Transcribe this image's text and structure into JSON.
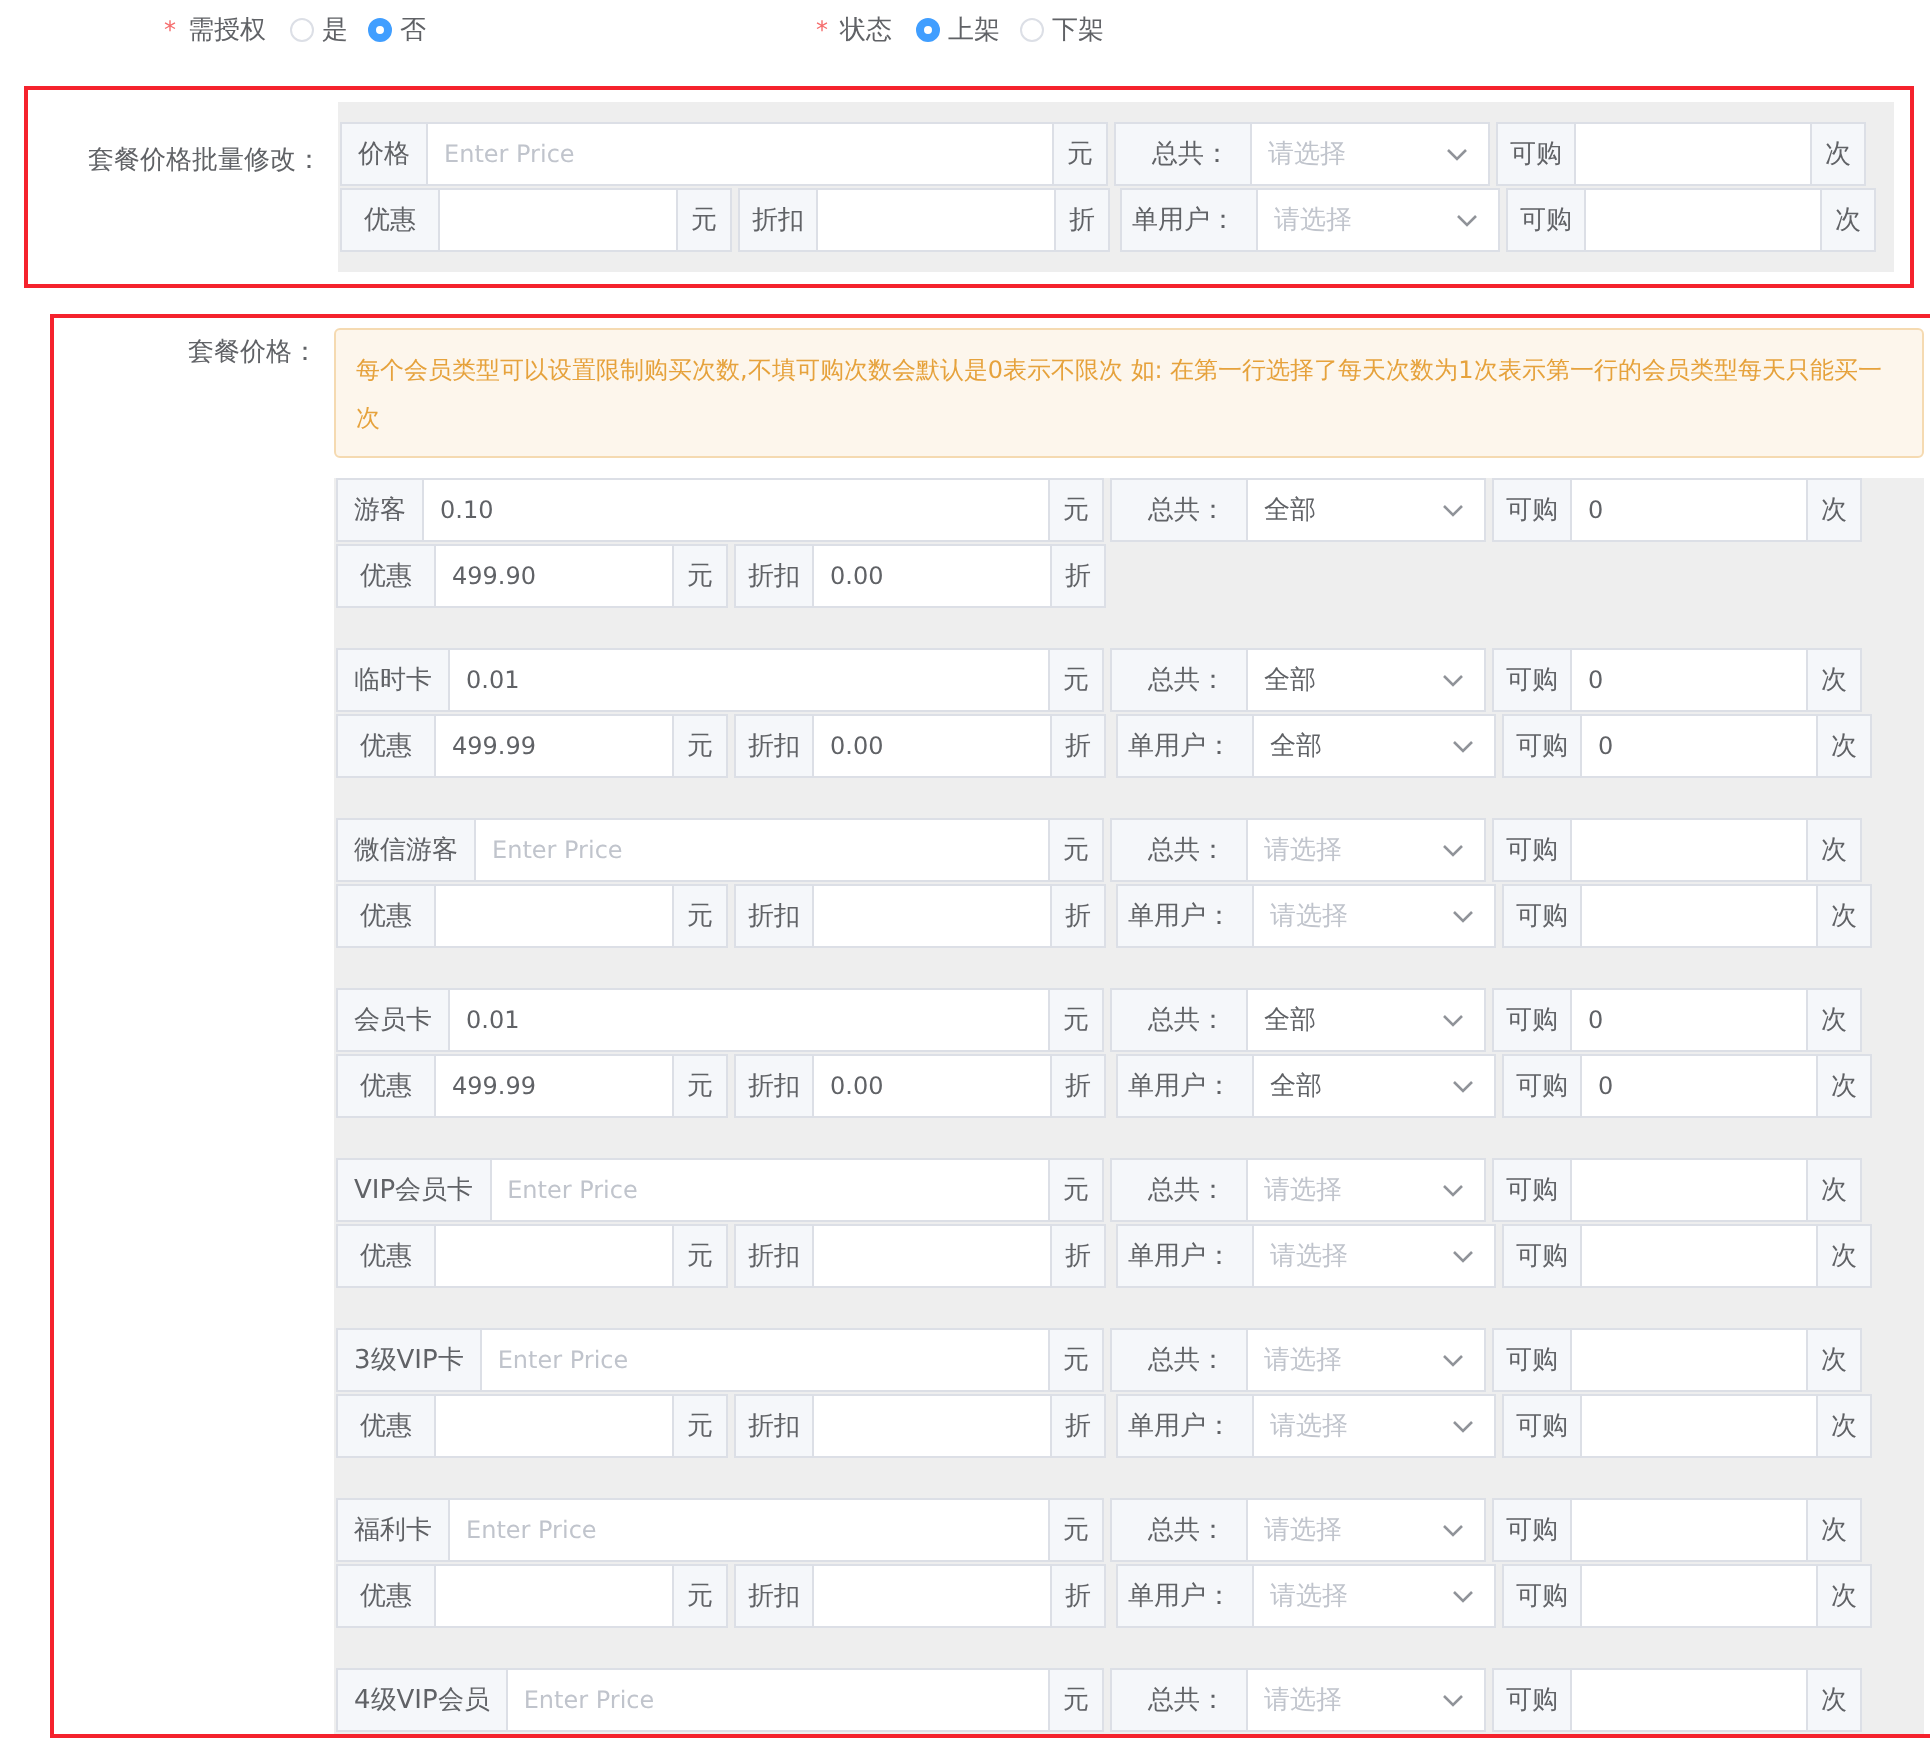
{
  "top_fields": [
    {
      "label": "需授权",
      "required_mark": "*",
      "options": [
        {
          "label": "是",
          "selected": false
        },
        {
          "label": "否",
          "selected": true
        }
      ]
    },
    {
      "label": "状态",
      "required_mark": "*",
      "options": [
        {
          "label": "上架",
          "selected": true
        },
        {
          "label": "下架",
          "selected": false
        }
      ]
    }
  ],
  "batch_edit": {
    "label": "套餐价格批量修改：",
    "group": {
      "name": "价格",
      "price": {
        "placeholder": "Enter Price",
        "unit": "元"
      },
      "total": {
        "label": "总共：",
        "placeholder": "请选择"
      },
      "total_buy": {
        "label": "可购",
        "unit": "次"
      },
      "discount": {
        "label": "优惠",
        "unit": "元"
      },
      "rate": {
        "label": "折扣",
        "unit": "折"
      },
      "per_user": {
        "label": "单用户：",
        "placeholder": "请选择"
      },
      "per_user_buy": {
        "label": "可购",
        "unit": "次"
      }
    }
  },
  "prices": {
    "label": "套餐价格：",
    "notice": "每个会员类型可以设置限制购买次数,不填可购次数会默认是0表示不限次 如: 在第一行选择了每天次数为1次表示第一行的会员类型每天只能买一次",
    "groups": [
      {
        "name": "游客",
        "price": {
          "value": "0.10",
          "unit": "元"
        },
        "total": {
          "label": "总共：",
          "value": "全部"
        },
        "total_buy": {
          "label": "可购",
          "value": "0",
          "unit": "次"
        },
        "discount": {
          "label": "优惠",
          "value": "499.90",
          "unit": "元"
        },
        "rate": {
          "label": "折扣",
          "value": "0.00",
          "unit": "折"
        }
      },
      {
        "name": "临时卡",
        "price": {
          "value": "0.01",
          "unit": "元"
        },
        "total": {
          "label": "总共：",
          "value": "全部"
        },
        "total_buy": {
          "label": "可购",
          "value": "0",
          "unit": "次"
        },
        "discount": {
          "label": "优惠",
          "value": "499.99",
          "unit": "元"
        },
        "rate": {
          "label": "折扣",
          "value": "0.00",
          "unit": "折"
        },
        "per_user": {
          "label": "单用户：",
          "value": "全部"
        },
        "per_user_buy": {
          "label": "可购",
          "value": "0",
          "unit": "次"
        }
      },
      {
        "name": "微信游客",
        "price": {
          "placeholder": "Enter Price",
          "unit": "元"
        },
        "total": {
          "label": "总共：",
          "placeholder": "请选择"
        },
        "total_buy": {
          "label": "可购",
          "unit": "次"
        },
        "discount": {
          "label": "优惠",
          "unit": "元"
        },
        "rate": {
          "label": "折扣",
          "unit": "折"
        },
        "per_user": {
          "label": "单用户：",
          "placeholder": "请选择"
        },
        "per_user_buy": {
          "label": "可购",
          "unit": "次"
        }
      },
      {
        "name": "会员卡",
        "price": {
          "value": "0.01",
          "unit": "元"
        },
        "total": {
          "label": "总共：",
          "value": "全部"
        },
        "total_buy": {
          "label": "可购",
          "value": "0",
          "unit": "次"
        },
        "discount": {
          "label": "优惠",
          "value": "499.99",
          "unit": "元"
        },
        "rate": {
          "label": "折扣",
          "value": "0.00",
          "unit": "折"
        },
        "per_user": {
          "label": "单用户：",
          "value": "全部"
        },
        "per_user_buy": {
          "label": "可购",
          "value": "0",
          "unit": "次"
        }
      },
      {
        "name": "VIP会员卡",
        "price": {
          "placeholder": "Enter Price",
          "unit": "元"
        },
        "total": {
          "label": "总共：",
          "placeholder": "请选择"
        },
        "total_buy": {
          "label": "可购",
          "unit": "次"
        },
        "discount": {
          "label": "优惠",
          "unit": "元"
        },
        "rate": {
          "label": "折扣",
          "unit": "折"
        },
        "per_user": {
          "label": "单用户：",
          "placeholder": "请选择"
        },
        "per_user_buy": {
          "label": "可购",
          "unit": "次"
        }
      },
      {
        "name": "3级VIP卡",
        "price": {
          "placeholder": "Enter Price",
          "unit": "元"
        },
        "total": {
          "label": "总共：",
          "placeholder": "请选择"
        },
        "total_buy": {
          "label": "可购",
          "unit": "次"
        },
        "discount": {
          "label": "优惠",
          "unit": "元"
        },
        "rate": {
          "label": "折扣",
          "unit": "折"
        },
        "per_user": {
          "label": "单用户：",
          "placeholder": "请选择"
        },
        "per_user_buy": {
          "label": "可购",
          "unit": "次"
        }
      },
      {
        "name": "福利卡",
        "price": {
          "placeholder": "Enter Price",
          "unit": "元"
        },
        "total": {
          "label": "总共：",
          "placeholder": "请选择"
        },
        "total_buy": {
          "label": "可购",
          "unit": "次"
        },
        "discount": {
          "label": "优惠",
          "unit": "元"
        },
        "rate": {
          "label": "折扣",
          "unit": "折"
        },
        "per_user": {
          "label": "单用户：",
          "placeholder": "请选择"
        },
        "per_user_buy": {
          "label": "可购",
          "unit": "次"
        }
      },
      {
        "name": "4级VIP会员",
        "price": {
          "placeholder": "Enter Price",
          "unit": "元"
        },
        "total": {
          "label": "总共：",
          "placeholder": "请选择"
        },
        "total_buy": {
          "label": "可购",
          "unit": "次"
        }
      }
    ]
  }
}
